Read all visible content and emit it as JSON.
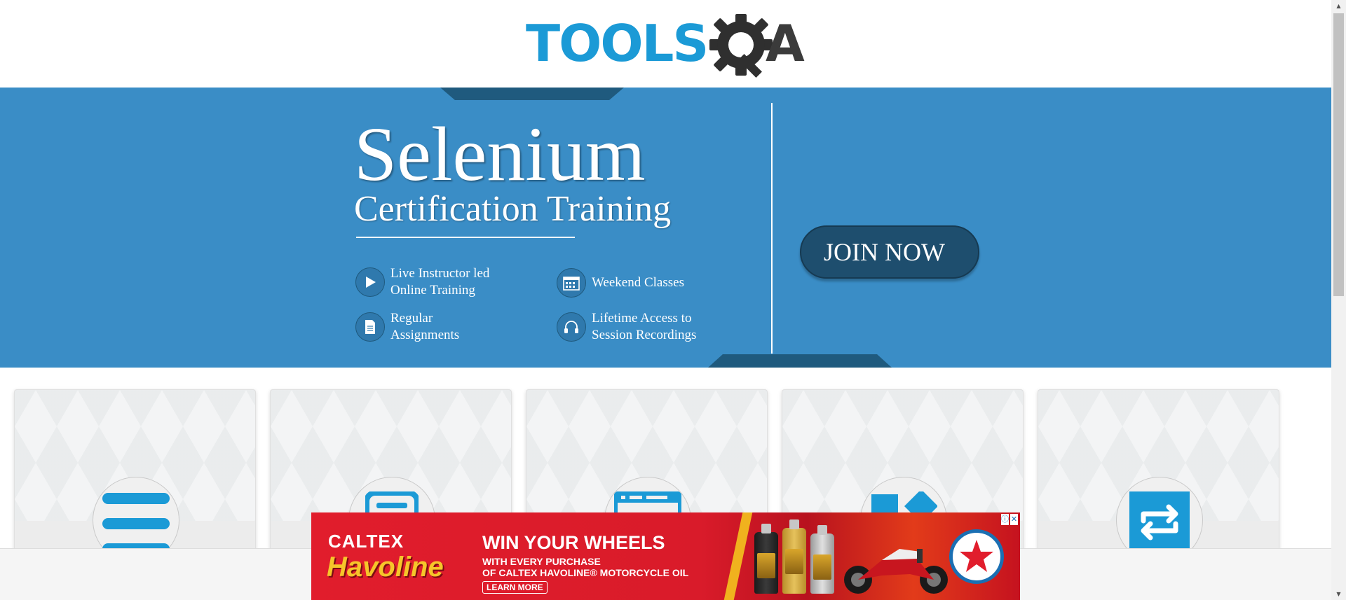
{
  "header": {
    "logo_text": "TOOLS",
    "logo_letter": "A"
  },
  "banner": {
    "title": "Selenium",
    "subtitle": "Certification Training",
    "features": [
      {
        "icon": "play-icon",
        "line1": "Live Instructor led",
        "line2": "Online Training"
      },
      {
        "icon": "calendar-icon",
        "line1": "Weekend Classes",
        "line2": ""
      },
      {
        "icon": "document-icon",
        "line1": "Regular",
        "line2": "Assignments"
      },
      {
        "icon": "headphones-icon",
        "line1": "Lifetime Access to",
        "line2": "Session Recordings"
      }
    ],
    "cta_label": "JOIN NOW"
  },
  "cards": [
    {
      "icon": "menu-lines-icon"
    },
    {
      "icon": "form-icon"
    },
    {
      "icon": "browser-window-icon"
    },
    {
      "icon": "widgets-icon"
    },
    {
      "icon": "interactions-icon"
    }
  ],
  "ad": {
    "brand": "CALTEX",
    "product": "Havoline",
    "headline": "WIN YOUR WHEELS",
    "sub1": "WITH EVERY PURCHASE",
    "sub2": "OF CALTEX HAVOLINE® MOTORCYCLE OIL",
    "cta": "LEARN MORE",
    "info_glyph": "ⓘ",
    "close_glyph": "✕"
  },
  "colors": {
    "brand_blue": "#1b9ad6",
    "banner_blue": "#3a8dc6",
    "button_navy": "#1e4e6e",
    "ad_red": "#e11d2c"
  }
}
